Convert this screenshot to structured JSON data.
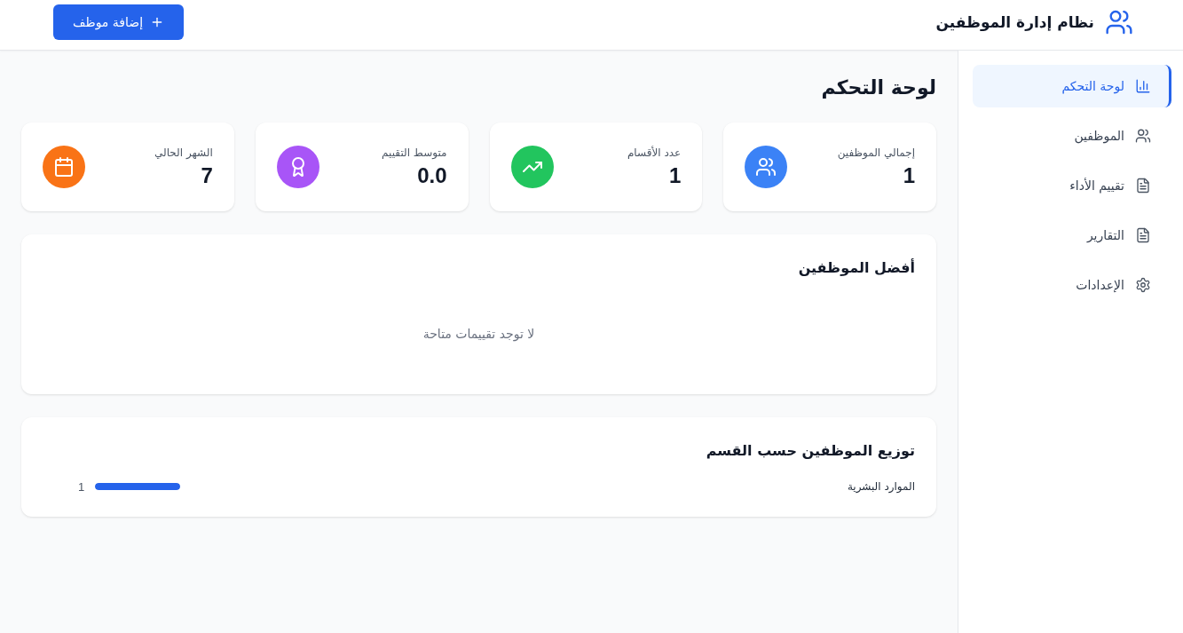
{
  "header": {
    "title": "نظام إدارة الموظفين",
    "add_button": "إضافة موظف"
  },
  "sidebar": {
    "items": [
      {
        "label": "لوحة التحكم",
        "selected": true
      },
      {
        "label": "الموظفين",
        "selected": false
      },
      {
        "label": "تقييم الأداء",
        "selected": false
      },
      {
        "label": "التقارير",
        "selected": false
      },
      {
        "label": "الإعدادات",
        "selected": false
      }
    ]
  },
  "page_title": "لوحة التحكم",
  "stats": [
    {
      "label": "إجمالي الموظفين",
      "value": "1",
      "color": "#3b82f6"
    },
    {
      "label": "عدد الأقسام",
      "value": "1",
      "color": "#22c55e"
    },
    {
      "label": "متوسط التقييم",
      "value": "0.0",
      "color": "#a855f7"
    },
    {
      "label": "الشهر الحالي",
      "value": "7",
      "color": "#f97316"
    }
  ],
  "top_employees": {
    "title": "أفضل الموظفين",
    "empty_message": "لا توجد تقييمات متاحة"
  },
  "department_distribution": {
    "title": "توزيع الموظفين حسب القسم",
    "rows": [
      {
        "name": "الموارد البشرية",
        "level": 1,
        "count": "1"
      }
    ]
  }
}
